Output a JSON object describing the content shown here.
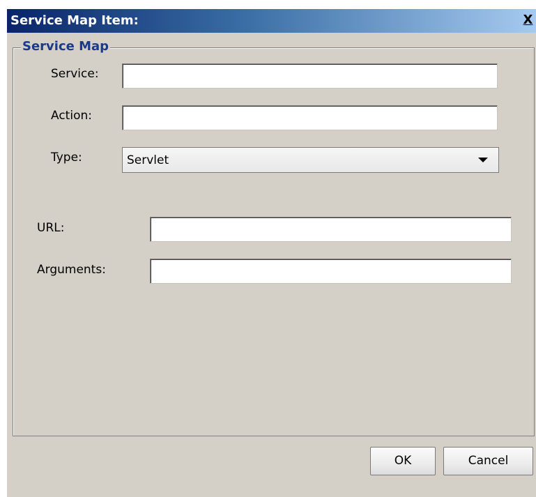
{
  "dialog": {
    "title": "Service Map Item:",
    "close_glyph": "X"
  },
  "group": {
    "title": "Service Map"
  },
  "fields": {
    "service": {
      "label": "Service:",
      "value": ""
    },
    "action": {
      "label": "Action:",
      "value": ""
    },
    "type": {
      "label": "Type:",
      "selected": "Servlet"
    },
    "url": {
      "label": "URL:",
      "value": ""
    },
    "arguments": {
      "label": "Arguments:",
      "value": ""
    }
  },
  "buttons": {
    "ok": "OK",
    "cancel": "Cancel"
  },
  "colors": {
    "title_gradient_start": "#0a246a",
    "title_gradient_end": "#a6caf0",
    "group_title": "#1b3a8c",
    "window_bg": "#d4d0c8"
  }
}
